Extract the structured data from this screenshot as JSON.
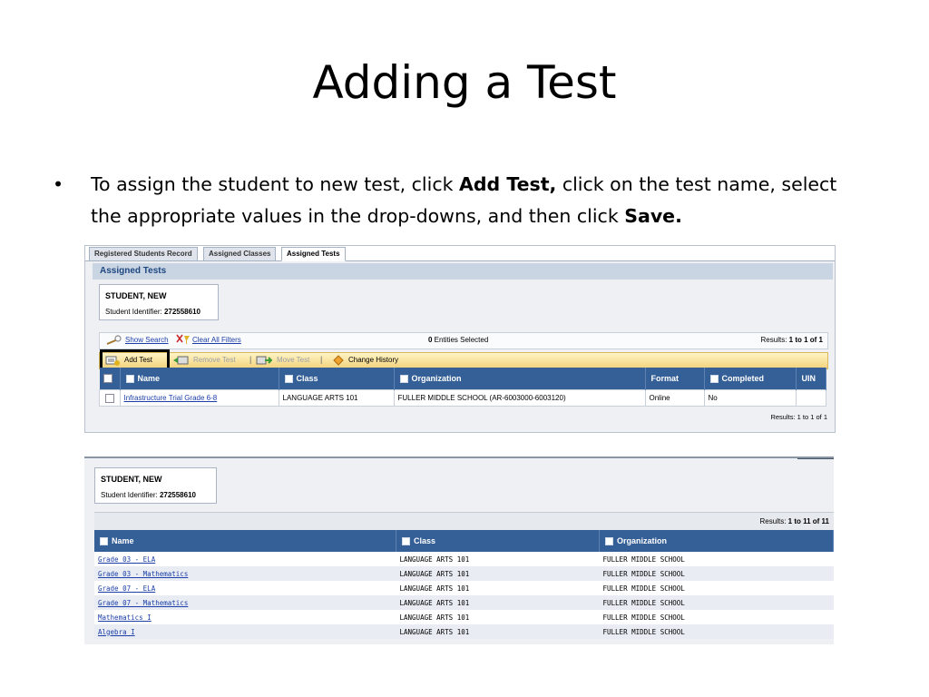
{
  "slide": {
    "title": "Adding a Test",
    "bullet": {
      "symbol": "•",
      "part1": "To assign the student to new test, click ",
      "bold1": "Add Test,",
      "part2": " click on the test name, select the appropriate values in the drop-downs, and then click ",
      "bold2": "Save."
    }
  },
  "screenshot1": {
    "tabs": [
      "Registered Students Record",
      "Assigned Classes",
      "Assigned Tests"
    ],
    "active_tab": "Assigned Tests",
    "section_title": "Assigned Tests",
    "student": {
      "name": "STUDENT, NEW",
      "id_label": "Student Identifier: ",
      "id_value": "272558610"
    },
    "filter_bar": {
      "show_search": "Show Search",
      "clear_filters": "Clear All Filters",
      "entities_count": "0",
      "entities_label": " Entities Selected",
      "results_label": "Results: ",
      "results_value": "1 to 1 of 1"
    },
    "toolbar": {
      "add_test": "Add Test",
      "remove_test": "Remove Test",
      "move_test": "Move Test",
      "change_history": "Change History",
      "separator": "|"
    },
    "table": {
      "headers": [
        "Name",
        "Class",
        "Organization",
        "Format",
        "Completed",
        "UIN"
      ],
      "rows": [
        {
          "name": "Infrastructure Trial Grade 6-8",
          "class": "LANGUAGE ARTS 101",
          "organization": "FULLER MIDDLE SCHOOL (AR-6003000-6003120)",
          "format": "Online",
          "completed": "No",
          "uin": ""
        }
      ]
    },
    "footer_results": "Results: 1 to 1 of 1",
    "colors": {
      "header_blue": "#355f97",
      "toolbar_gold": "#f3d27a",
      "link_blue": "#1b3ea8"
    }
  },
  "screenshot2": {
    "student": {
      "name": "STUDENT, NEW",
      "id_label": "Student Identifier: ",
      "id_value": "272558610"
    },
    "results_label": "Results: ",
    "results_value": "1 to 11 of 11",
    "table": {
      "headers": [
        "Name",
        "Class",
        "Organization"
      ],
      "rows": [
        {
          "name": "Grade 03 - ELA",
          "class": "LANGUAGE ARTS 101",
          "organization": "FULLER MIDDLE SCHOOL"
        },
        {
          "name": "Grade 03 - Mathematics",
          "class": "LANGUAGE ARTS 101",
          "organization": "FULLER MIDDLE SCHOOL"
        },
        {
          "name": "Grade 07 - ELA",
          "class": "LANGUAGE ARTS 101",
          "organization": "FULLER MIDDLE SCHOOL"
        },
        {
          "name": "Grade 07 - Mathematics",
          "class": "LANGUAGE ARTS 101",
          "organization": "FULLER MIDDLE SCHOOL"
        },
        {
          "name": "Mathematics I",
          "class": "LANGUAGE ARTS 101",
          "organization": "FULLER MIDDLE SCHOOL"
        },
        {
          "name": "Algebra I",
          "class": "LANGUAGE ARTS 101",
          "organization": "FULLER MIDDLE SCHOOL"
        }
      ]
    }
  }
}
